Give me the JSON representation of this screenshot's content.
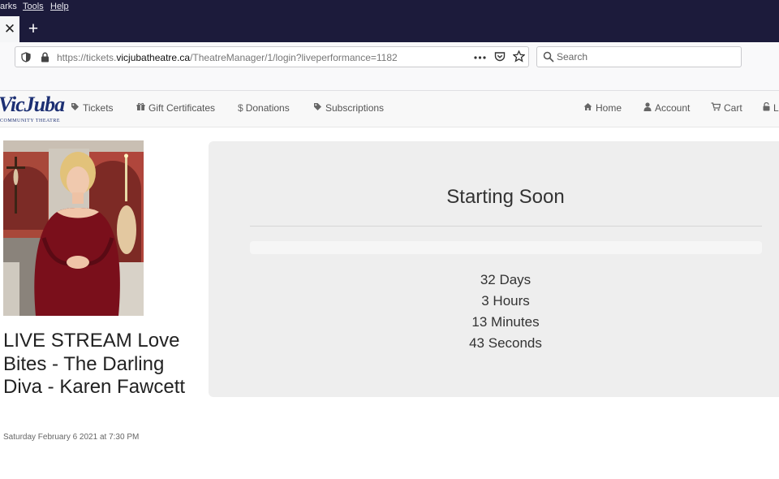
{
  "browser": {
    "menu": [
      "arks",
      "Tools",
      "Help"
    ],
    "tab_close_glyph": "✕",
    "new_tab_glyph": "+",
    "url_prefix": "https://tickets.",
    "url_domain": "vicjubatheatre.ca",
    "url_path": "/TheatreManager/1/login?liveperformance=1182",
    "search_placeholder": "Search",
    "icons": [
      "shield-icon",
      "lock-icon",
      "more-icon",
      "pocket-icon",
      "bookmark-star-icon",
      "search-icon"
    ]
  },
  "site": {
    "logo_text": "VicJuba",
    "logo_subtext": "COMMUNITY THEATRE",
    "nav_left": [
      {
        "label": "Tickets",
        "icon": "tag-icon"
      },
      {
        "label": "Gift Certificates",
        "icon": "gift-icon"
      },
      {
        "label": "Donations",
        "icon": "dollar-icon"
      },
      {
        "label": "Subscriptions",
        "icon": "tag-icon"
      }
    ],
    "nav_right": [
      {
        "label": "Home",
        "icon": "home-icon"
      },
      {
        "label": "Account",
        "icon": "user-icon"
      },
      {
        "label": "Cart",
        "icon": "cart-icon"
      },
      {
        "label": "L",
        "icon": "lock-icon"
      }
    ]
  },
  "event": {
    "title": "LIVE STREAM Love Bites - The Darling Diva - Karen Fawcett",
    "date": "Saturday February 6 2021 at 7:30 PM"
  },
  "status": {
    "title": "Starting Soon",
    "progress": 0,
    "days": "32 Days",
    "hours": "3 Hours",
    "minutes": "13 Minutes",
    "seconds": "43 Seconds"
  },
  "colors": {
    "chrome_dark": "#1c1b3b",
    "logo_blue": "#1c2f73",
    "panel_bg": "#eeeeee"
  }
}
